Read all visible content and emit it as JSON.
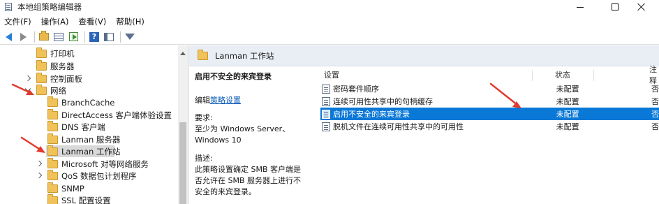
{
  "window": {
    "title": "本地组策略编辑器"
  },
  "menu": [
    {
      "label": "文件(F)"
    },
    {
      "label": "操作(A)"
    },
    {
      "label": "查看(V)"
    },
    {
      "label": "帮助(H)"
    }
  ],
  "toolbar": {
    "icons": [
      "back-icon",
      "forward-icon",
      "up-folder-icon",
      "show-hide-tree-icon",
      "export-list-icon",
      "help-icon",
      "view-icon",
      "filter-icon"
    ]
  },
  "tree": {
    "items": [
      {
        "label": "打印机",
        "indent": 1,
        "expander": "none"
      },
      {
        "label": "服务器",
        "indent": 1,
        "expander": "none"
      },
      {
        "label": "控制面板",
        "indent": 1,
        "expander": "closed"
      },
      {
        "label": "网络",
        "indent": 1,
        "expander": "open"
      },
      {
        "label": "BranchCache",
        "indent": 2,
        "expander": "none"
      },
      {
        "label": "DirectAccess 客户端体验设置",
        "indent": 2,
        "expander": "none"
      },
      {
        "label": "DNS 客户端",
        "indent": 2,
        "expander": "none"
      },
      {
        "label": "Lanman 服务器",
        "indent": 2,
        "expander": "none"
      },
      {
        "label": "Lanman 工作站",
        "indent": 2,
        "expander": "none",
        "selected": true
      },
      {
        "label": "Microsoft 对等网络服务",
        "indent": 2,
        "expander": "closed"
      },
      {
        "label": "QoS 数据包计划程序",
        "indent": 2,
        "expander": "closed"
      },
      {
        "label": "SNMP",
        "indent": 2,
        "expander": "none"
      },
      {
        "label": "SSL 配置设置",
        "indent": 2,
        "expander": "none"
      }
    ]
  },
  "header": {
    "folder_label": "Lanman 工作站"
  },
  "description": {
    "title": "启用不安全的来宾登录",
    "edit_prefix": "编辑",
    "edit_link": "策略设置",
    "requirements_label": "要求:",
    "requirements_text": "至少为 Windows Server、Windows 10",
    "desc_label": "描述:",
    "desc_text": "此策略设置确定 SMB 客户端是否允许在 SMB 服务器上进行不安全的来宾登录。"
  },
  "list": {
    "columns": {
      "name": "设置",
      "state": "状态",
      "note": "注释"
    },
    "rows": [
      {
        "name": "密码套件顺序",
        "state": "未配置",
        "note": "否"
      },
      {
        "name": "连续可用性共享中的句柄缓存",
        "state": "未配置",
        "note": "否"
      },
      {
        "name": "启用不安全的来宾登录",
        "state": "未配置",
        "note": "否",
        "selected": true
      },
      {
        "name": "脱机文件在连续可用性共享中的可用性",
        "state": "未配置",
        "note": "否"
      }
    ]
  },
  "colors": {
    "selection_blue": "#0a78d7",
    "annotation_red": "#e23b2e",
    "link_blue": "#0b5cb8"
  }
}
